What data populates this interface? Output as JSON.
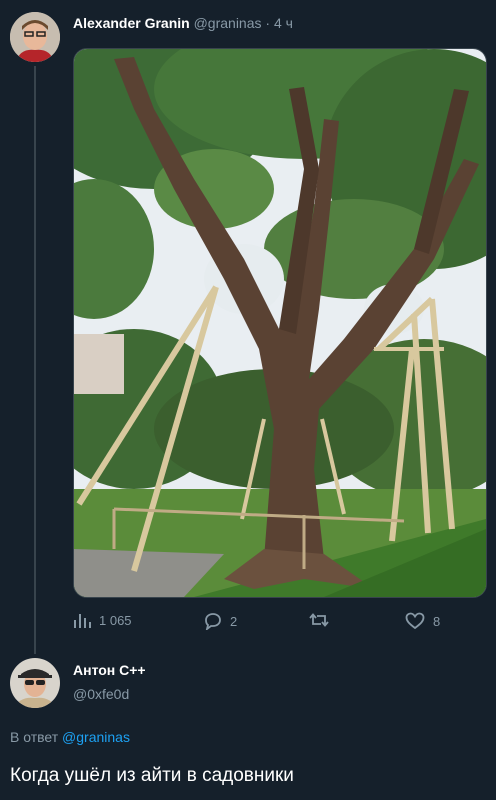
{
  "tweet1": {
    "author_name": "Alexander Granin",
    "author_handle": "@graninas",
    "separator": "·",
    "time": "4 ч",
    "image_icon": "tree-photo",
    "stats": {
      "views": "1 065",
      "replies": "2",
      "retweets": "",
      "likes": "8"
    }
  },
  "tweet2": {
    "author_name": "Антон С++",
    "author_handle": "@0xfe0d",
    "reply_prefix": "В ответ",
    "reply_handle": "@graninas",
    "text": "Когда ушёл из айти в садовники"
  },
  "colors": {
    "background": "#15202b",
    "muted": "#8899a6",
    "accent": "#1da1f2",
    "divider": "#38444d"
  }
}
